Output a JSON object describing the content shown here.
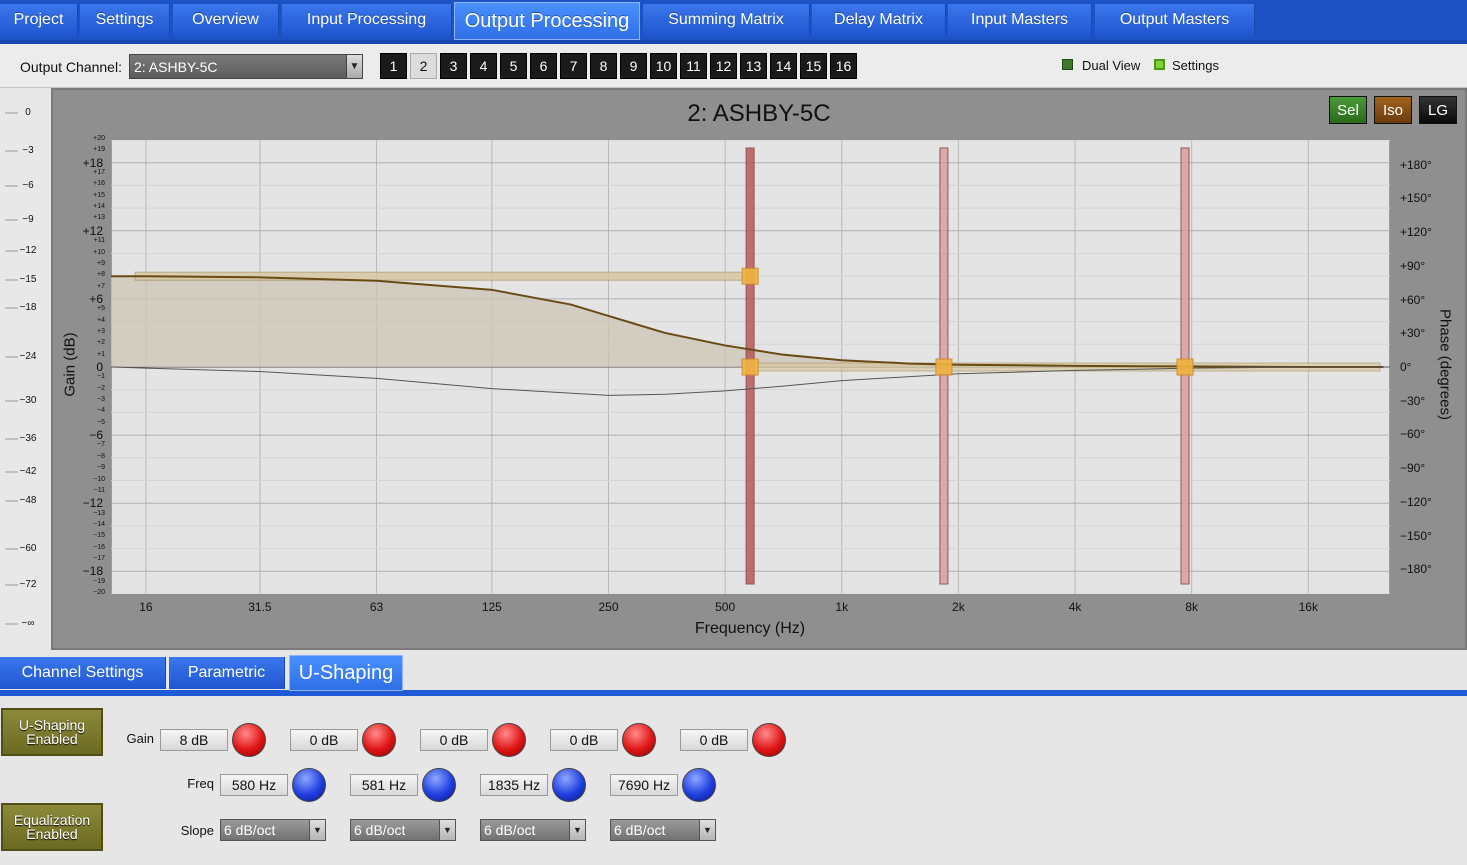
{
  "nav": {
    "tabs": [
      {
        "label": "Project"
      },
      {
        "label": "Settings"
      },
      {
        "label": "Overview"
      },
      {
        "label": "Input Processing"
      },
      {
        "label": "Output Processing"
      },
      {
        "label": "Summing Matrix"
      },
      {
        "label": "Delay Matrix"
      },
      {
        "label": "Input Masters"
      },
      {
        "label": "Output Masters"
      }
    ],
    "active": "Output Processing"
  },
  "channel": {
    "label": "Output Channel:",
    "selected": "2: ASHBY-5C",
    "buttons": [
      "1",
      "2",
      "3",
      "4",
      "5",
      "6",
      "7",
      "8",
      "9",
      "10",
      "11",
      "12",
      "13",
      "14",
      "15",
      "16"
    ],
    "selected_button": "2"
  },
  "legend": {
    "dual_view": "Dual View",
    "settings": "Settings"
  },
  "graph": {
    "title": "2: ASHBY-5C",
    "buttons": {
      "sel": "Sel",
      "iso": "Iso",
      "lg": "LG"
    },
    "xlabel": "Frequency (Hz)",
    "ylabel": "Gain (dB)",
    "y2label": "Phase (degrees)",
    "xticks": [
      "16",
      "31.5",
      "63",
      "125",
      "250",
      "500",
      "1k",
      "2k",
      "4k",
      "8k",
      "16k"
    ],
    "yticks_major": [
      "+18",
      "+12",
      "+6",
      "0",
      "−6",
      "−12",
      "−18"
    ],
    "phase_ticks": [
      "+180°",
      "+150°",
      "+120°",
      "+90°",
      "+60°",
      "+30°",
      "0°",
      "−30°",
      "−60°",
      "−90°",
      "−120°",
      "−150°",
      "−180°"
    ]
  },
  "meter": {
    "ticks": [
      "0",
      "−3",
      "−6",
      "−9",
      "−12",
      "−15",
      "−18",
      "−24",
      "−30",
      "−36",
      "−42",
      "−48",
      "−60",
      "−72",
      "−∞"
    ]
  },
  "bottom_tabs": [
    {
      "label": "Channel Settings"
    },
    {
      "label": "Parametric"
    },
    {
      "label": "U-Shaping"
    }
  ],
  "bottom_active": "U-Shaping",
  "ushaping": {
    "enabled_label": "U-Shaping Enabled",
    "eq_enabled_label": "Equalization Enabled",
    "gain_label": "Gain",
    "freq_label": "Freq",
    "slope_label": "Slope",
    "gains": [
      "8 dB",
      "0 dB",
      "0 dB",
      "0 dB",
      "0 dB"
    ],
    "freqs": [
      "580 Hz",
      "581 Hz",
      "1835 Hz",
      "7690 Hz"
    ],
    "slopes": [
      "6 dB/oct",
      "6 dB/oct",
      "6 dB/oct",
      "6 dB/oct"
    ]
  },
  "chart_data": {
    "type": "line",
    "title": "2: ASHBY-5C",
    "xlabel": "Frequency (Hz)",
    "ylabel": "Gain (dB)",
    "xscale": "log",
    "xlim": [
      13,
      26000
    ],
    "ylim": [
      -20,
      20
    ],
    "series": [
      {
        "x": [
          13,
          16,
          31.5,
          63,
          125,
          200,
          250,
          350,
          500,
          700,
          1000,
          1500,
          2000,
          4000,
          8000,
          16000,
          25000
        ],
        "values": [
          8.0,
          8.0,
          7.9,
          7.6,
          6.8,
          5.5,
          4.5,
          3.0,
          1.9,
          1.1,
          0.6,
          0.3,
          0.2,
          0.1,
          0.05,
          0.0,
          0.0
        ]
      },
      {
        "x": [
          13,
          16,
          31.5,
          63,
          125,
          250,
          350,
          500,
          700,
          1000,
          2000,
          4000,
          8000,
          16000,
          25000
        ],
        "values": [
          0,
          -0.1,
          -0.4,
          -1.0,
          -1.9,
          -2.5,
          -2.4,
          -2.1,
          -1.7,
          -1.2,
          -0.6,
          -0.3,
          -0.1,
          0,
          0
        ]
      }
    ],
    "markers_hz": [
      580,
      1835,
      7690
    ]
  }
}
